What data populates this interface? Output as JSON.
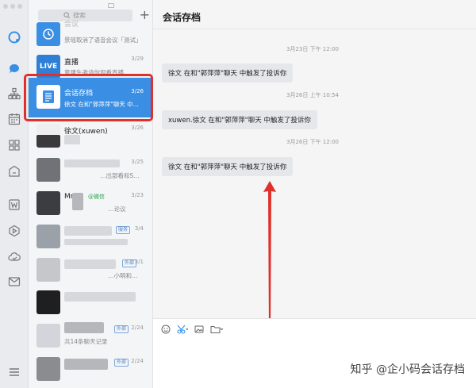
{
  "search": {
    "placeholder": "搜索"
  },
  "list": {
    "items": [
      {
        "name": "会议",
        "date": "",
        "preview": "景瑶取消了语音会议「测试」"
      },
      {
        "name": "直播",
        "date": "3/29",
        "preview": "童建生邀请你观看直播"
      },
      {
        "name": "会话存档",
        "date": "3/26",
        "preview": "徐文 在和\"郭萍萍\"聊天 中..."
      },
      {
        "name": "徐文(xuwen)",
        "date": "3/26",
        "preview": ""
      },
      {
        "name": "",
        "date": "3/25",
        "preview": "…出部看和S…"
      },
      {
        "name": "Mr.",
        "date": "3/23",
        "preview": "…论议",
        "badge": "@微信"
      },
      {
        "name": "",
        "date": "3/4",
        "preview": "",
        "tag": "服务"
      },
      {
        "name": "",
        "date": "3/1",
        "preview": "…小明和…",
        "tag": "外部"
      },
      {
        "name": "",
        "date": "",
        "preview": ""
      },
      {
        "name": "",
        "date": "2/24",
        "preview": "共14条聊天记录",
        "tag": "外部"
      },
      {
        "name": "",
        "date": "2/24",
        "preview": "",
        "tag": "外部"
      }
    ]
  },
  "chat": {
    "title": "会话存档",
    "messages": [
      {
        "time": "3月23日 下午 12:00",
        "text": "徐文 在和\"郭萍萍\"聊天 中触发了投诉你"
      },
      {
        "time": "3月26日 上午 10:54",
        "text": "xuwen.徐文 在和\"郭萍萍\"聊天 中触发了投诉你"
      },
      {
        "time": "3月26日 下午 12:00",
        "text": "徐文 在和\"郭萍萍\"聊天 中触发了投诉你"
      }
    ]
  },
  "watermark": "知乎 @企小码会话存档",
  "colors": {
    "selected": "#3a8fe4",
    "highlight": "#e0302c",
    "arrow": "#e0302c"
  },
  "rail_icons": [
    "workbench-logo-icon",
    "message-icon",
    "contacts-icon",
    "calendar-icon",
    "apps-icon",
    "drive-icon",
    "document-icon",
    "slides-icon",
    "cloud-icon",
    "mail-icon",
    "menu-icon"
  ]
}
